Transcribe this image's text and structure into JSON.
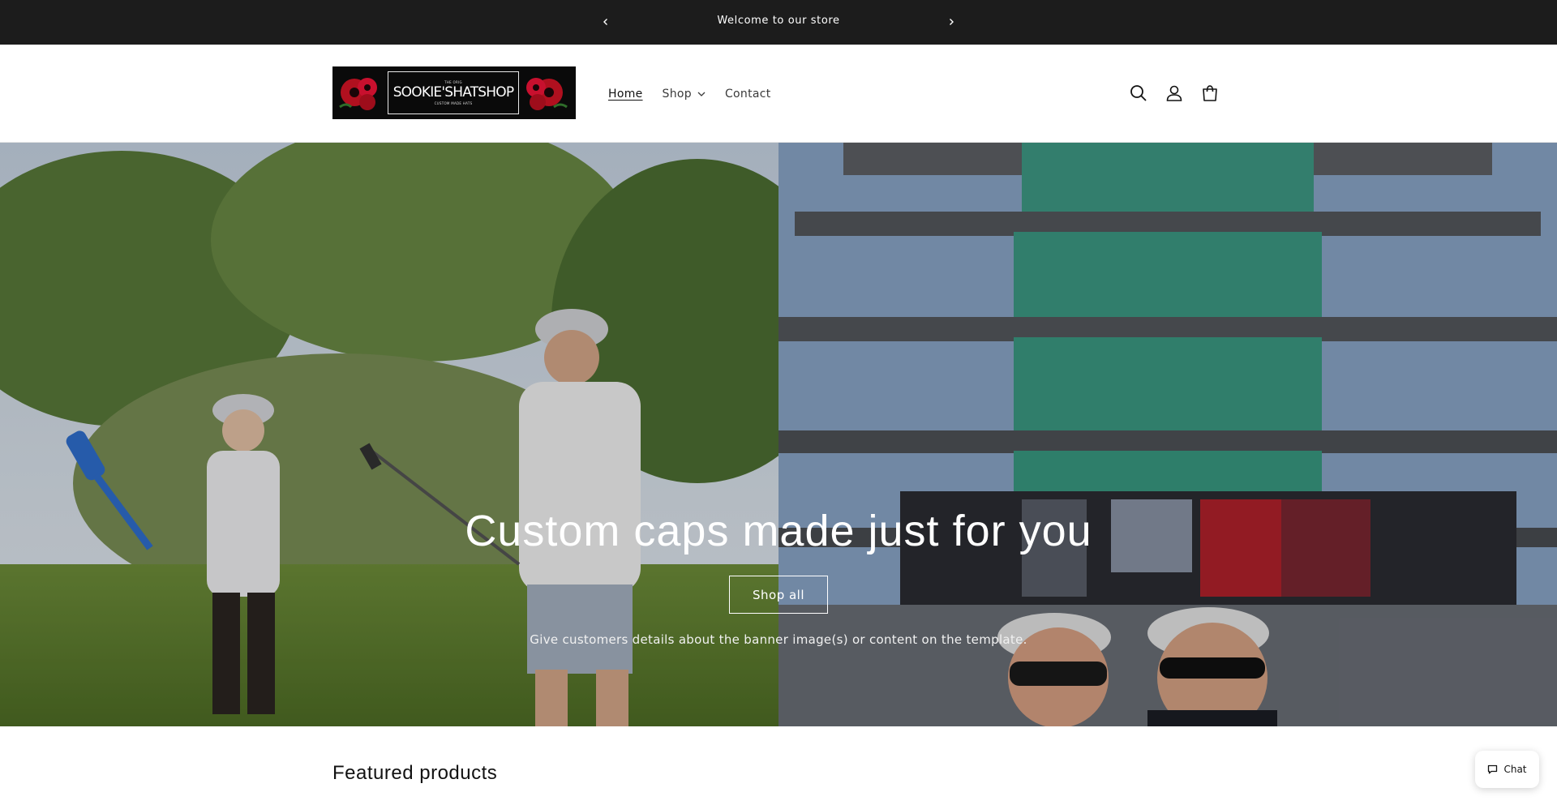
{
  "announcement": {
    "message": "Welcome to our store",
    "prev_icon": "chevron-left-icon",
    "next_icon": "chevron-right-icon"
  },
  "header": {
    "logo": {
      "brand": "SOOKIE'SHATSHOP",
      "tagline_top": "THE ORIG",
      "tagline_bottom": "CUSTOM MADE HATS"
    },
    "nav": [
      {
        "label": "Home",
        "active": true
      },
      {
        "label": "Shop",
        "has_dropdown": true
      },
      {
        "label": "Contact"
      }
    ],
    "icons": [
      "search-icon",
      "account-icon",
      "cart-icon"
    ]
  },
  "hero": {
    "heading": "Custom caps made just for you",
    "button_label": "Shop all",
    "subtext": "Give customers details about the banner image(s) or content on the template."
  },
  "featured": {
    "heading": "Featured products"
  },
  "chat": {
    "label": "Chat"
  },
  "colors": {
    "announcement_bg": "#1c1c1c",
    "text": "#121212",
    "accent_red": "#c8102e"
  }
}
